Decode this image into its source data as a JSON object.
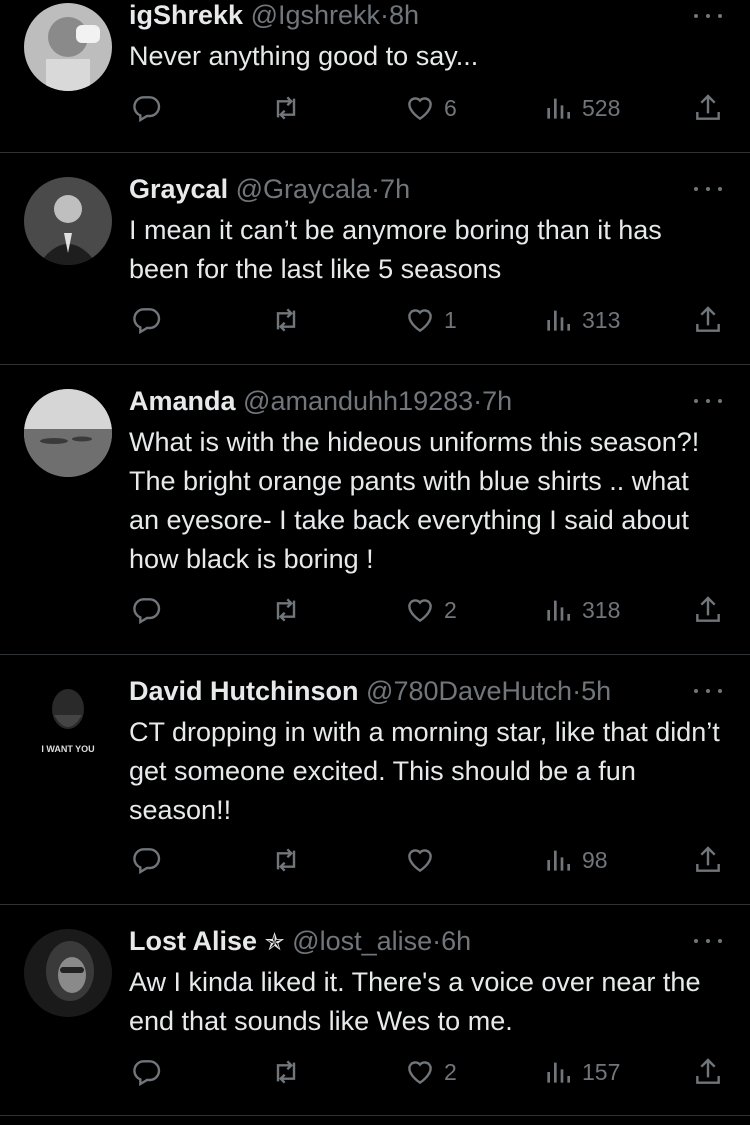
{
  "colors": {
    "background": "#000000",
    "text": "#e7e9ea",
    "muted": "#71767b",
    "divider": "#2f3336"
  },
  "tweets": [
    {
      "name": "igShrekk",
      "handle": "@Igshrekk",
      "dot": "·",
      "time": "8h",
      "text": "Never anything good to say...",
      "actions": {
        "reply_icon": "reply-icon",
        "retweet_icon": "retweet-icon",
        "like_icon": "heart-icon",
        "likes": "6",
        "views_icon": "views-icon",
        "views": "528",
        "share_icon": "share-icon"
      }
    },
    {
      "name": "Graycal",
      "handle": "@Graycala",
      "dot": "·",
      "time": "7h",
      "text": "I mean it can’t be anymore boring than it has been for the last like 5 seasons",
      "actions": {
        "likes": "1",
        "views": "313"
      }
    },
    {
      "name": "Amanda",
      "handle": "@amanduhh19283",
      "dot": "·",
      "time": "7h",
      "text": "What is with the hideous uniforms this season?! The bright orange pants with blue shirts .. what an eyesore- I take back everything I said about how black is boring !",
      "actions": {
        "likes": "2",
        "views": "318"
      }
    },
    {
      "name": "David Hutchinson",
      "handle": "@780DaveHutch",
      "dot": "·",
      "time": "5h",
      "text": "CT dropping in with a morning star, like that didn’t get someone excited. This should be a fun season!!",
      "avatar_text": "I WANT YOU",
      "actions": {
        "likes": "",
        "views": "98"
      }
    },
    {
      "name": "Lost Alise",
      "badge": "✯",
      "handle": "@lost_alise",
      "dot": "·",
      "time": "6h",
      "text": "Aw I kinda liked it. There's a voice over near the end that sounds like Wes to me.",
      "actions": {
        "likes": "2",
        "views": "157"
      }
    }
  ]
}
